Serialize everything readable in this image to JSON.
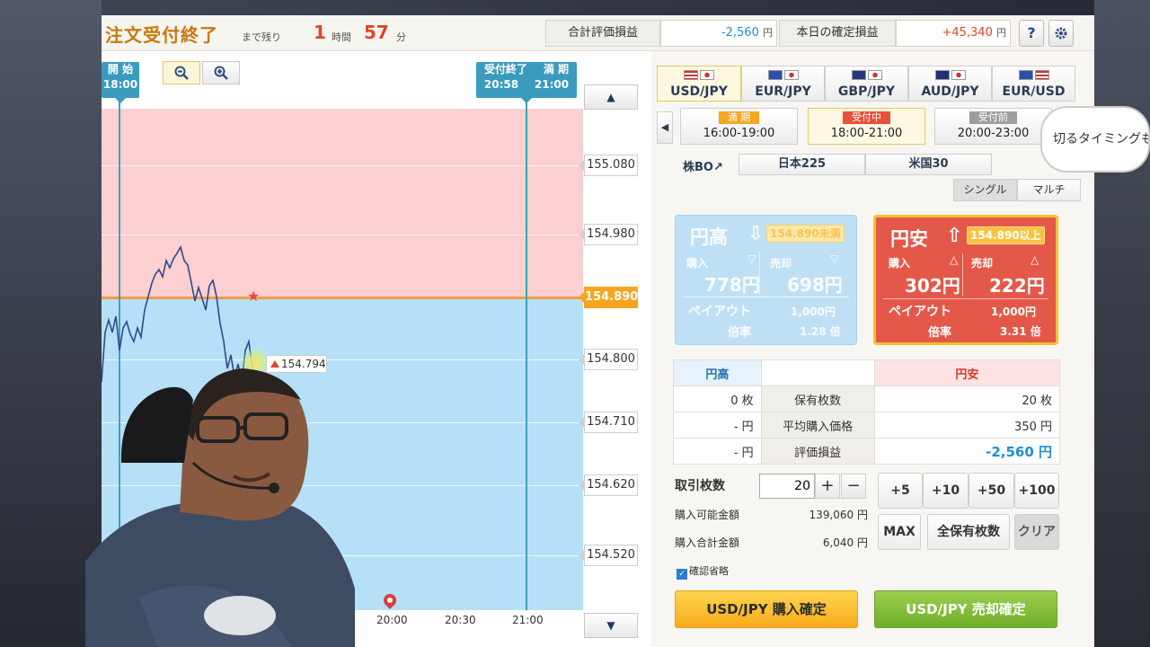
{
  "header": {
    "title": "注文受付終了",
    "remain_label": "まで残り",
    "hours": "1",
    "hours_unit": "時間",
    "minutes": "57",
    "minutes_unit": "分",
    "eval_pl_label": "合計評価損益",
    "eval_pl_value": "-2,560",
    "eval_pl_unit": "円",
    "realized_label": "本日の確定損益",
    "realized_value": "+45,340",
    "realized_unit": "円",
    "help": "?",
    "settings_icon": "gear-icon"
  },
  "chart": {
    "start_label": "開 始",
    "start_time": "18:00",
    "close_label": "受付終了",
    "close_time": "20:58",
    "expiry_label": "満 期",
    "expiry_time": "21:00",
    "zoom_out_icon": "zoom-out-icon",
    "zoom_in_icon": "zoom-in-icon",
    "price_ticks": [
      "155.080",
      "154.980",
      "154.890",
      "154.800",
      "154.710",
      "154.620",
      "154.520"
    ],
    "target_price": "154.890",
    "current_price": "154.794",
    "x_ticks": [
      "20:00",
      "20:30",
      "21:00"
    ],
    "colors": {
      "above": "#fcd0d0",
      "below": "#b6e0f7",
      "target": "#f29b4b",
      "line": "#2f4a8a"
    }
  },
  "pairs": [
    {
      "label": "USD/JPY",
      "active": true
    },
    {
      "label": "EUR/JPY",
      "active": false
    },
    {
      "label": "GBP/JPY",
      "active": false
    },
    {
      "label": "AUD/JPY",
      "active": false
    },
    {
      "label": "EUR/USD",
      "active": false
    }
  ],
  "sessions": [
    {
      "status": "満 期",
      "time": "16:00-19:00",
      "color": "#f5a623"
    },
    {
      "status": "受付中",
      "time": "18:00-21:00",
      "color": "#e8503a"
    },
    {
      "status": "受付前",
      "time": "20:00-23:00",
      "color": "#9e9e9e"
    }
  ],
  "index": {
    "label": "株BO↗",
    "buttons": [
      "日本225",
      "米国30"
    ]
  },
  "mode": {
    "single": "シングル",
    "multi": "マルチ"
  },
  "up_card": {
    "title": "円高",
    "badge": "154.890未満",
    "buy_label": "購入",
    "buy_price": "778円",
    "sell_label": "売却",
    "sell_price": "698円",
    "payout_label": "ペイアウト",
    "payout_value": "1,000円",
    "rate_label": "倍率",
    "rate_value": "1.28 倍"
  },
  "down_card": {
    "title": "円安",
    "badge": "154.890以上",
    "buy_label": "購入",
    "buy_price": "302円",
    "sell_label": "売却",
    "sell_price": "222円",
    "payout_label": "ペイアウト",
    "payout_value": "1,000円",
    "rate_label": "倍率",
    "rate_value": "3.31 倍"
  },
  "stats": {
    "col_left": "円高",
    "col_right": "円安",
    "rows": [
      {
        "label": "保有枚数",
        "left": "0 枚",
        "right": "20 枚"
      },
      {
        "label": "平均購入価格",
        "left": "- 円",
        "right": "350 円"
      },
      {
        "label": "評価損益",
        "left": "- 円",
        "right": "-2,560 円"
      }
    ]
  },
  "order": {
    "qty_label": "取引枚数",
    "qty_value": "20",
    "plus": "+",
    "minus": "−",
    "avail_label": "購入可能金額",
    "avail_value": "139,060 円",
    "total_label": "購入合計金額",
    "total_value": "6,040 円",
    "add5": "+5",
    "add10": "+10",
    "add50": "+50",
    "add100": "+100",
    "max": "MAX",
    "all": "全保有枚数",
    "clear": "クリア",
    "confirm_skip": "確認省略",
    "buy_btn": "USD/JPY 購入確定",
    "sell_btn": "USD/JPY 売却確定"
  },
  "overlay_text": "切るタイミングも"
}
